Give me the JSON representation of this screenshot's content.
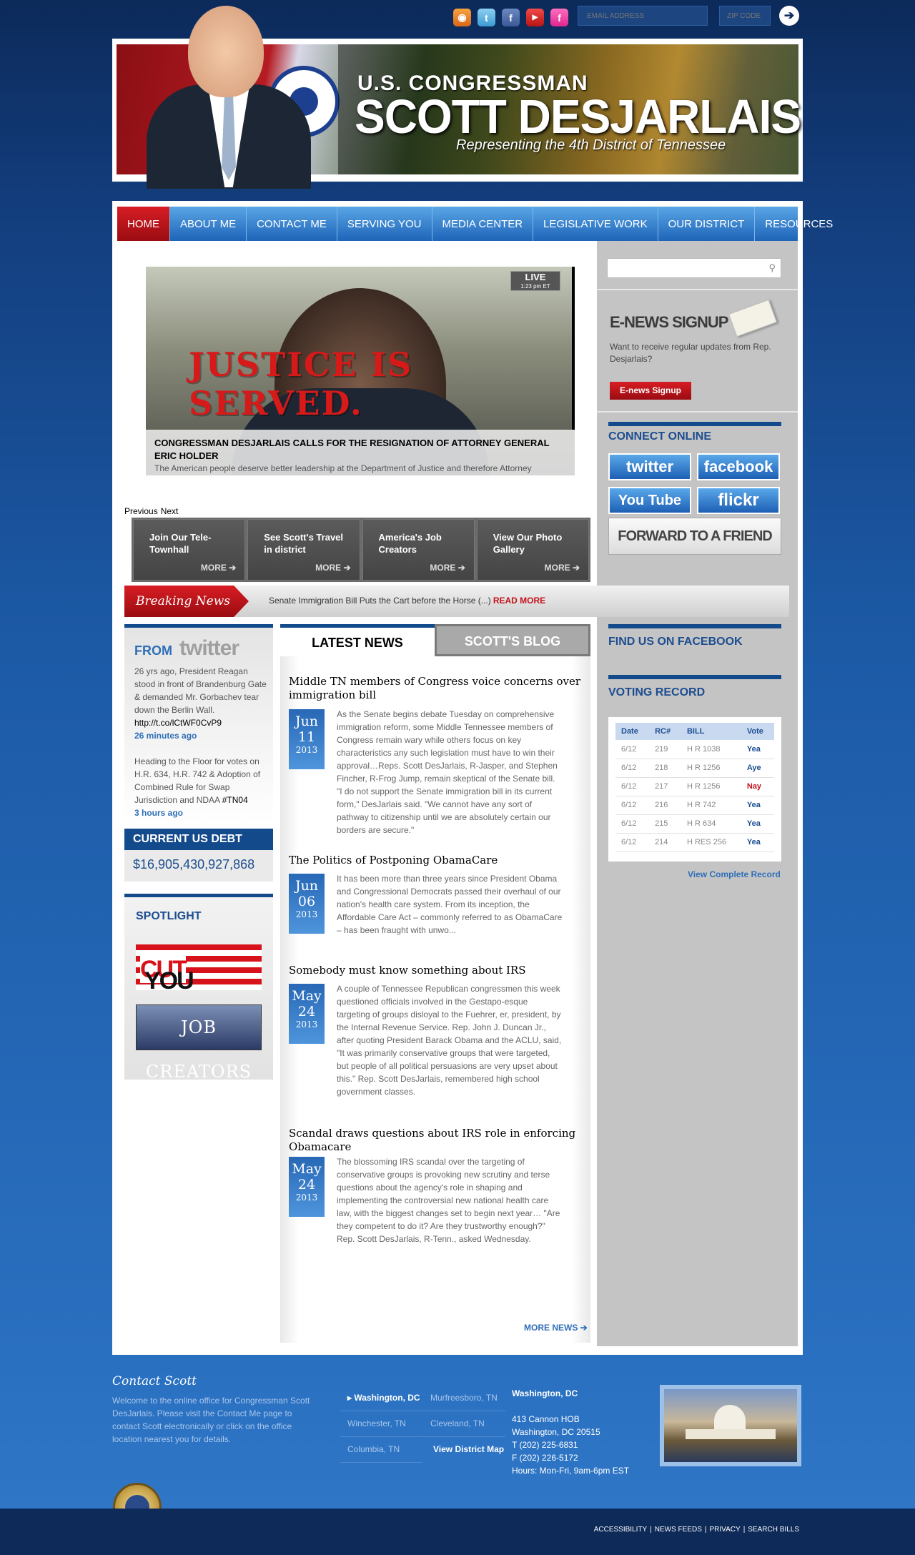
{
  "top": {
    "email_placeholder": "EMAIL ADDRESS",
    "zip_placeholder": "ZIP CODE",
    "go_symbol": "➔",
    "social_icons": [
      "rss-icon",
      "twitter-icon",
      "facebook-icon",
      "youtube-icon",
      "flickr-icon"
    ]
  },
  "banner": {
    "kicker": "U.S. CONGRESSMAN",
    "name": "SCOTT DESJARLAIS",
    "tagline": "Representing the 4th District of Tennessee"
  },
  "nav": {
    "items": [
      "HOME",
      "ABOUT ME",
      "CONTACT ME",
      "SERVING YOU",
      "MEDIA CENTER",
      "LEGISLATIVE WORK",
      "OUR DISTRICT",
      "RESOURCES"
    ]
  },
  "slider": {
    "live_label": "LIVE",
    "live_time": "1:23 pm ET",
    "stamp": "JUSTICE IS SERVED.",
    "caption_title": "CONGRESSMAN DESJARLAIS CALLS FOR THE RESIGNATION OF ATTORNEY GENERAL ERIC HOLDER",
    "caption_text": "The American people deserve better leadership at the Department of Justice and therefore Attorney",
    "prev": "Previous",
    "next": "Next"
  },
  "features": [
    {
      "title": "Join Our Tele-Townhall",
      "more": "MORE"
    },
    {
      "title": "See Scott's Travel in district",
      "more": "MORE"
    },
    {
      "title": "America's Job Creators",
      "more": "MORE"
    },
    {
      "title": "View Our Photo Gallery",
      "more": "MORE"
    }
  ],
  "breaking": {
    "label": "Breaking News",
    "text": "Senate Immigration Bill Puts the Cart before the Horse (...)",
    "more": "READ MORE"
  },
  "twitter": {
    "from": "FROM",
    "logo": "twitter",
    "tweets": [
      {
        "text": "26 yrs ago, President Reagan stood in front of Brandenburg Gate & demanded Mr. Gorbachev tear down the Berlin Wall.",
        "link": "http://t.co/lCtWF0CvP9",
        "time": "26 minutes ago"
      },
      {
        "text": "Heading to the Floor for votes on H.R. 634, H.R. 742 & Adoption of Combined Rule for Swap Jurisdiction and NDAA",
        "link": "#TN04",
        "time": "3 hours ago"
      }
    ]
  },
  "debt": {
    "title": "CURRENT US DEBT",
    "value": "$16,905,430,927,868"
  },
  "spotlight": {
    "title": "SPOTLIGHT",
    "youcut_you": "YOU",
    "youcut_cut": "CUT",
    "job_creators": "JOB CREATORS"
  },
  "news_tabs": [
    "LATEST NEWS",
    "SCOTT'S BLOG"
  ],
  "articles": [
    {
      "title": "Middle TN members of Congress voice concerns over immigration bill",
      "month": "Jun",
      "day": "11",
      "year": "2013",
      "body": "As the Senate begins debate Tuesday on comprehensive immigration reform, some Middle Tennessee members of Congress remain wary while others focus on key characteristics any such legislation must have to win their approval…Reps. Scott DesJarlais, R-Jasper, and Stephen Fincher, R-Frog Jump, remain skeptical of the Senate bill. \"I do not support the Senate immigration bill in its current form,\" DesJarlais said. \"We cannot have any sort of pathway to citizenship until we are absolutely certain our borders are secure.\""
    },
    {
      "title": "The Politics of Postponing ObamaCare",
      "month": "Jun",
      "day": "06",
      "year": "2013",
      "body": "It has been more than three years since President Obama and Congressional Democrats passed their overhaul of our nation's health care system. From its inception, the Affordable Care Act – commonly referred to as ObamaCare – has been fraught with unwo..."
    },
    {
      "title": "Somebody must know something about IRS",
      "month": "May",
      "day": "24",
      "year": "2013",
      "body": "A couple of Tennessee Republican congressmen this week questioned officials involved in the Gestapo-esque targeting of groups disloyal to the Fuehrer, er, president, by the Internal Revenue Service. Rep. John J. Duncan Jr., after quoting President Barack Obama and the ACLU, said, \"It was primarily conservative groups that were targeted, but people of all political persuasions are very upset about this.\" Rep. Scott DesJarlais, remembered high school government classes."
    },
    {
      "title": "Scandal draws questions about IRS role in enforcing Obamacare",
      "month": "May",
      "day": "24",
      "year": "2013",
      "body": "The blossoming IRS scandal over the targeting of conservative groups is provoking new scrutiny and terse questions about the agency's role in shaping and implementing the controversial new national health care law, with the biggest changes set to begin next year… \"Are they competent to do it? Are they trustworthy enough?\" Rep. Scott DesJarlais, R-Tenn., asked Wednesday."
    }
  ],
  "more_news": "MORE NEWS ➔",
  "right": {
    "enews_title": "E-NEWS SIGNUP",
    "enews_text": "Want to receive regular updates from Rep. Desjarlais?",
    "enews_button": "E-news Signup",
    "connect_title": "CONNECT ONLINE",
    "connect_buttons": [
      "twitter",
      "facebook",
      "You Tube",
      "flickr"
    ],
    "forward": "FORWARD TO A FRIEND",
    "facebook_title": "FIND US ON FACEBOOK",
    "voting_title": "VOTING RECORD",
    "vote_headers": [
      "Date",
      "RC#",
      "BILL",
      "Vote"
    ],
    "votes": [
      [
        "6/12",
        "219",
        "H R 1038",
        "Yea"
      ],
      [
        "6/12",
        "218",
        "H R 1256",
        "Aye"
      ],
      [
        "6/12",
        "217",
        "H R 1256",
        "Nay"
      ],
      [
        "6/12",
        "216",
        "H R 742",
        "Yea"
      ],
      [
        "6/12",
        "215",
        "H R 634",
        "Yea"
      ],
      [
        "6/12",
        "214",
        "H RES 256",
        "Yea"
      ]
    ],
    "view_record": "View Complete Record"
  },
  "footer": {
    "title": "Contact Scott",
    "text": "Welcome to the online office for Congressman Scott DesJarlais. Please visit the Contact Me page to contact Scott electronically or click on the office location nearest you for details.",
    "locations": [
      "Washington, DC",
      "Murfreesboro, TN",
      "Winchester, TN",
      "Cleveland, TN",
      "Columbia, TN",
      "View District Map"
    ],
    "address_title": "Washington, DC",
    "address_lines": [
      "413 Cannon HOB",
      "Washington, DC 20515",
      "T (202) 225-6831",
      "F (202) 226-5172",
      "Hours: Mon-Fri, 9am-6pm EST"
    ],
    "links": [
      "ACCESSIBILITY",
      "NEWS FEEDS",
      "PRIVACY",
      "SEARCH BILLS"
    ]
  },
  "colors": {
    "brand_blue": "#134a8c",
    "accent_red": "#c4121a",
    "link_blue": "#2f6fb8"
  }
}
